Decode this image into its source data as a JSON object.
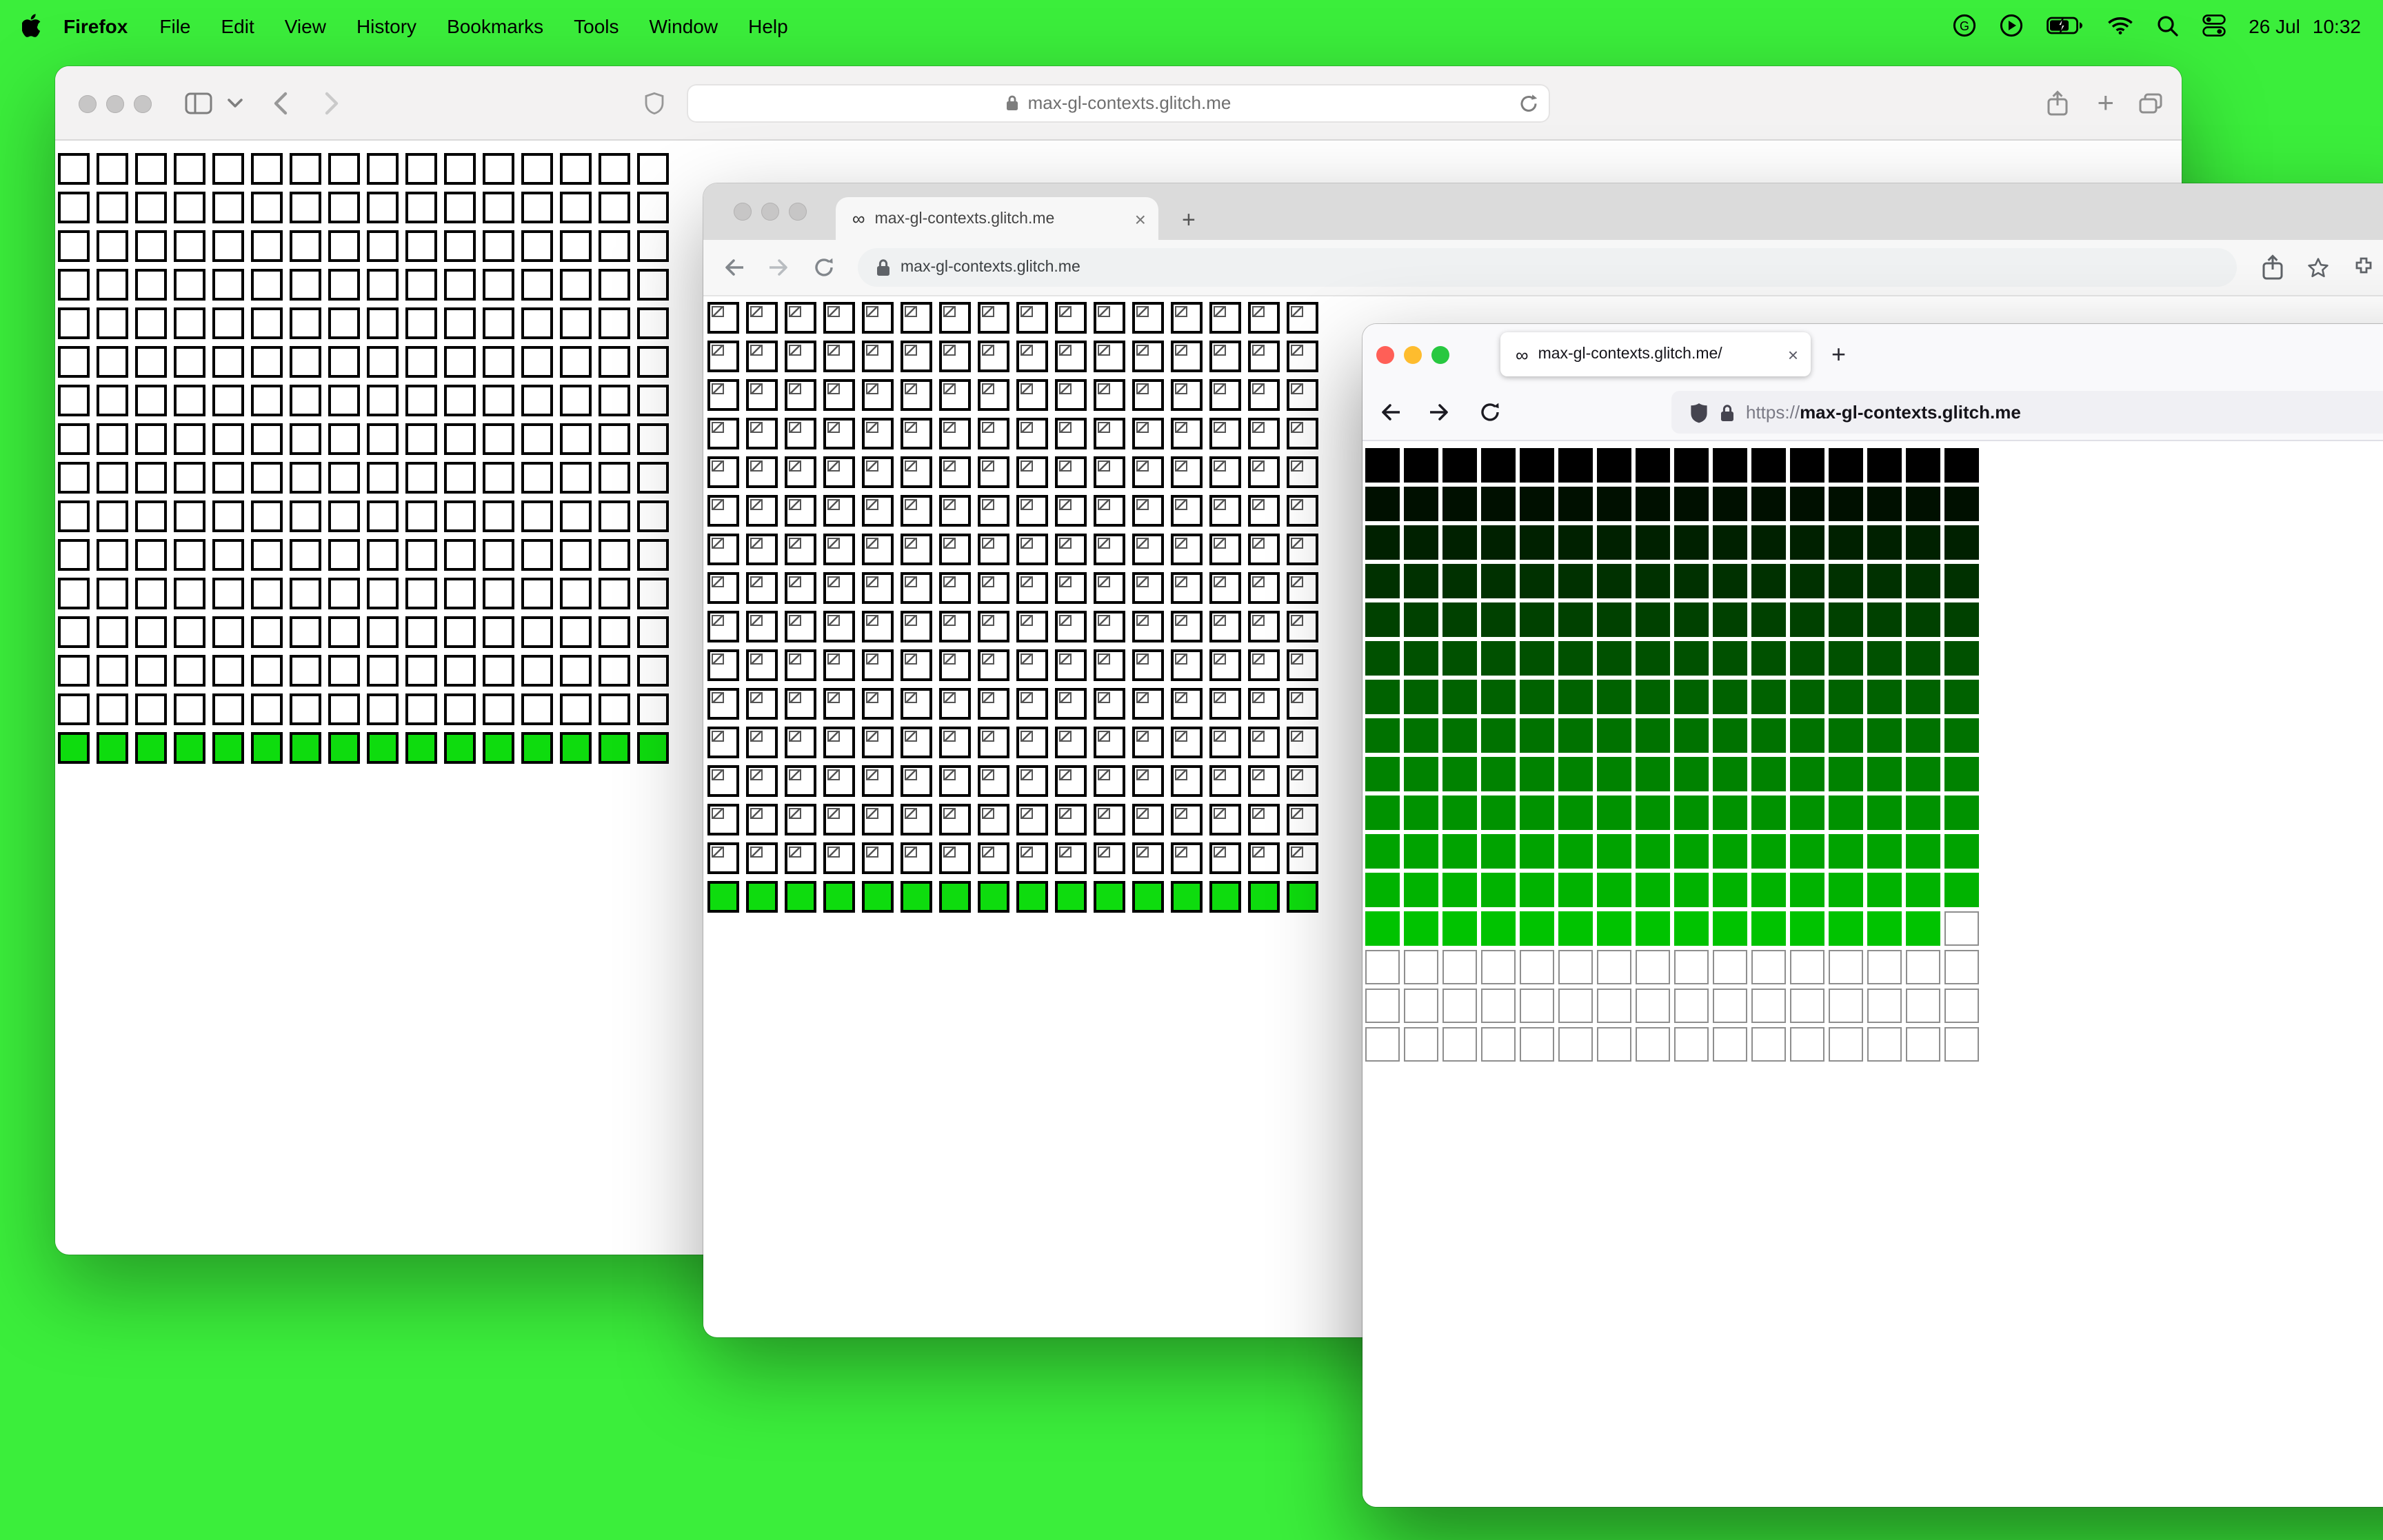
{
  "desktop": {
    "background_color": "#3BEE3B"
  },
  "menubar": {
    "app_name": "Firefox",
    "menus": [
      "File",
      "Edit",
      "View",
      "History",
      "Bookmarks",
      "Tools",
      "Window",
      "Help"
    ],
    "status_icons": [
      "g-circle",
      "play-circle",
      "battery-charging",
      "wifi",
      "spotlight",
      "control-center"
    ],
    "date": "26 Jul",
    "time": "10:32"
  },
  "glyphs": {
    "plus": "+",
    "close": "×",
    "infinity": "∞"
  },
  "windows": {
    "safari": {
      "url": "max-gl-contexts.glitch.me",
      "grid": {
        "cols": 16,
        "rows": 16,
        "green_row_indices": [
          15
        ],
        "green_fill": "#0EDC0E"
      }
    },
    "chrome": {
      "tab_title": "max-gl-contexts.glitch.me",
      "url": "max-gl-contexts.glitch.me",
      "grid": {
        "cols": 16,
        "rows": 16,
        "green_row_indices": [
          15
        ],
        "green_fill": "#0EDC0E",
        "broken_image_cells": true
      }
    },
    "firefox": {
      "tab_title": "max-gl-contexts.glitch.me/",
      "url_scheme": "https://",
      "url_host": "max-gl-contexts.glitch.me",
      "grid": {
        "cols": 16,
        "rows": 16,
        "gradient_rows": 13,
        "gradient_from": "#000000",
        "gradient_to": "#00C300",
        "partial_row_index": 12,
        "partial_green_count": 15,
        "empty_cell_border": "#8E8E8E"
      }
    }
  }
}
